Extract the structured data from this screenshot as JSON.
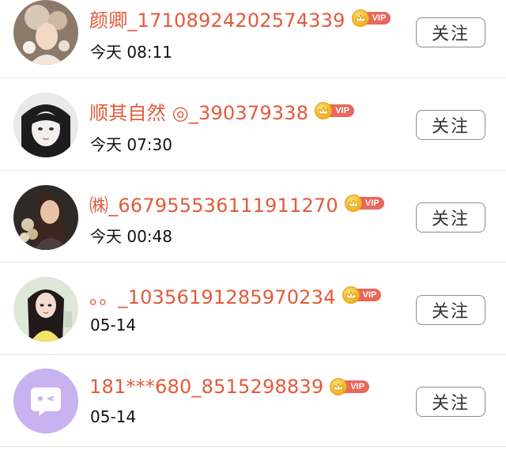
{
  "follow_list": {
    "users": [
      {
        "name": "颜卿_17108924202574339",
        "time": "今天 08:11",
        "vip": "VIP",
        "button": "关注"
      },
      {
        "name": "顺其自然 ◎_390379338",
        "time": "今天 07:30",
        "vip": "VIP",
        "button": "关注"
      },
      {
        "name": "㈱_667955536111911270",
        "time": "今天 00:48",
        "vip": "VIP",
        "button": "关注"
      },
      {
        "name": "。。_10356191285970234",
        "time": "05-14",
        "vip": "VIP",
        "button": "关注"
      },
      {
        "name": "181***680_8515298839",
        "time": "05-14",
        "vip": "VIP",
        "button": "关注"
      }
    ]
  },
  "colors": {
    "name": "#e35a3a",
    "vip_tag": "#e8685a",
    "vip_crown": "#f3b11f",
    "default_avatar_bg": "#c8b2f0"
  },
  "icons": [
    "crown-icon",
    "default-chat-avatar-icon"
  ]
}
